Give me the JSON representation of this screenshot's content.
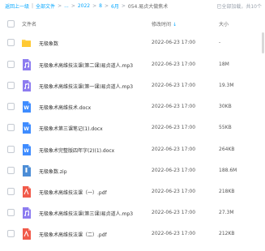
{
  "breadcrumb": {
    "back": "返回上一级",
    "items": [
      "全部文件",
      "...",
      "2022",
      "8",
      "6月",
      "054.易贞大做焦术"
    ],
    "loaded_status": "已全部加载，共10个"
  },
  "columns": {
    "name": "文件名",
    "modified": "修改时间",
    "size": "大小"
  },
  "files": [
    {
      "name": "无极象数",
      "modified": "2022-06-23 17:00",
      "size": "-",
      "type": "folder-icon"
    },
    {
      "name": "无极象术高维技法课(第二课)易贞道人.mp3",
      "modified": "2022-06-23 17:00",
      "size": "18M",
      "type": "audio-icon"
    },
    {
      "name": "无极象术高维技法课(第一课)易贞道人.mp3",
      "modified": "2022-06-23 17:00",
      "size": "19.3M",
      "type": "audio-icon"
    },
    {
      "name": "无极象术高维技术.docx",
      "modified": "2022-06-23 17:00",
      "size": "30KB",
      "type": "word-icon"
    },
    {
      "name": "无极象术第三课笔记(1).docx",
      "modified": "2022-06-23 17:00",
      "size": "55KB",
      "type": "word-icon"
    },
    {
      "name": "无极象术完整版四年字(2)(1).docx",
      "modified": "2022-06-23 17:00",
      "size": "264KB",
      "type": "word-icon"
    },
    {
      "name": "无极象数.zip",
      "modified": "2022-06-23 17:00",
      "size": "188.6M",
      "type": "zip-icon"
    },
    {
      "name": "无极象术高维技法课（一）.pdf",
      "modified": "2022-06-23 17:00",
      "size": "218KB",
      "type": "pdf-icon"
    },
    {
      "name": "无极象术高维技法课(第三课)易贞道人.mp3",
      "modified": "2022-06-23 17:00",
      "size": "27.3M",
      "type": "audio-icon"
    },
    {
      "name": "无极象术高维技法课（二）.pdf",
      "modified": "2022-06-23 17:00",
      "size": "212KB",
      "type": "pdf-icon"
    }
  ],
  "colors": {
    "accent": "#06a7ff",
    "folder": "#ffd24d",
    "audio": "#8d7cf0",
    "word": "#3f8cff",
    "zip": "#4c8dd6",
    "pdf": "#f15a4a"
  }
}
